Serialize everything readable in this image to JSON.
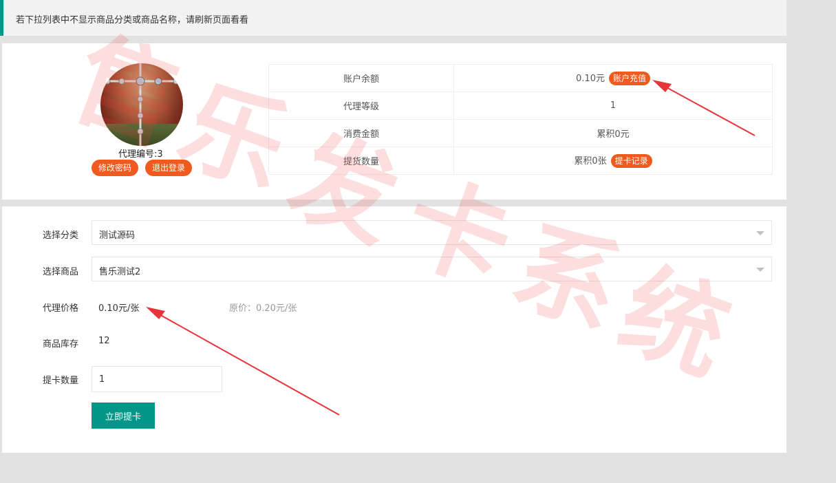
{
  "notice": "若下拉列表中不显示商品分类或商品名称，请刷新页面看看",
  "profile": {
    "agent_id": "代理编号:3",
    "change_password": "修改密码",
    "logout": "退出登录"
  },
  "account": {
    "balance_label": "账户余额",
    "balance_value": "0.10元",
    "recharge": "账户充值",
    "level_label": "代理等级",
    "level_value": "1",
    "spend_label": "消费金额",
    "spend_value": "累积0元",
    "pickup_label": "提货数量",
    "pickup_value": "累积0张",
    "pickup_record": "提卡记录"
  },
  "form": {
    "category_label": "选择分类",
    "category_value": "测试源码",
    "product_label": "选择商品",
    "product_value": "售乐测试2",
    "price_label": "代理价格",
    "price_value": "0.10元/张",
    "original_price": "原价：0.20元/张",
    "stock_label": "商品库存",
    "stock_value": "12",
    "qty_label": "提卡数量",
    "qty_value": "1",
    "submit": "立即提卡"
  },
  "watermark": [
    "售",
    "乐",
    "发",
    "卡",
    "系",
    "统"
  ],
  "colors": {
    "accent": "#009688",
    "orange": "#f05a1e",
    "arrow": "#e8333a",
    "watermark": "#f03c3c"
  }
}
